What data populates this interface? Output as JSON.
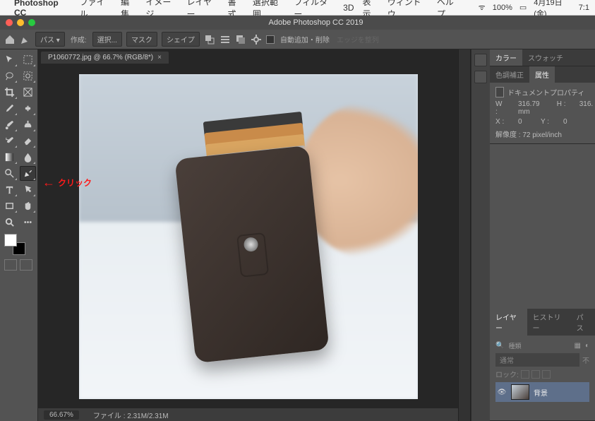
{
  "mac_menu": {
    "app": "Photoshop CC",
    "items": [
      "ファイル",
      "編集",
      "イメージ",
      "レイヤー",
      "書式",
      "選択範囲",
      "フィルター",
      "3D",
      "表示",
      "ウィンドウ",
      "ヘルプ"
    ],
    "battery": "100%",
    "date": "4月19日(金)",
    "time": "7:1"
  },
  "window": {
    "title": "Adobe Photoshop CC 2019"
  },
  "options": {
    "mode_label": "パス",
    "make_label": "作成:",
    "make_options": [
      "選択...",
      "マスク",
      "シェイプ"
    ],
    "auto_label": "自動追加・削除",
    "align_label": "エッジを整列"
  },
  "document": {
    "tab": "P1060772.jpg @ 66.7% (RGB/8*)",
    "zoom": "66.67%",
    "filesize": "ファイル : 2.31M/2.31M"
  },
  "panels": {
    "color_tabs": [
      "カラー",
      "スウォッチ"
    ],
    "adjust_tabs": [
      "色調補正",
      "属性"
    ],
    "props_title": "ドキュメントプロパティ",
    "props": {
      "W_lbl": "W :",
      "W_val": "316.79 mm",
      "H_lbl": "H :",
      "H_val": "316.",
      "X_lbl": "X :",
      "X_val": "0",
      "Y_lbl": "Y :",
      "Y_val": "0"
    },
    "resolution": "解像度 : 72 pixel/inch",
    "layer_tabs": [
      "レイヤー",
      "ヒストリー",
      "パス"
    ],
    "layer_search": "種類",
    "layer_blend": "通常",
    "layer_lock": "ロック:",
    "layer_name": "背景"
  },
  "annotation": {
    "text": "クリック"
  }
}
